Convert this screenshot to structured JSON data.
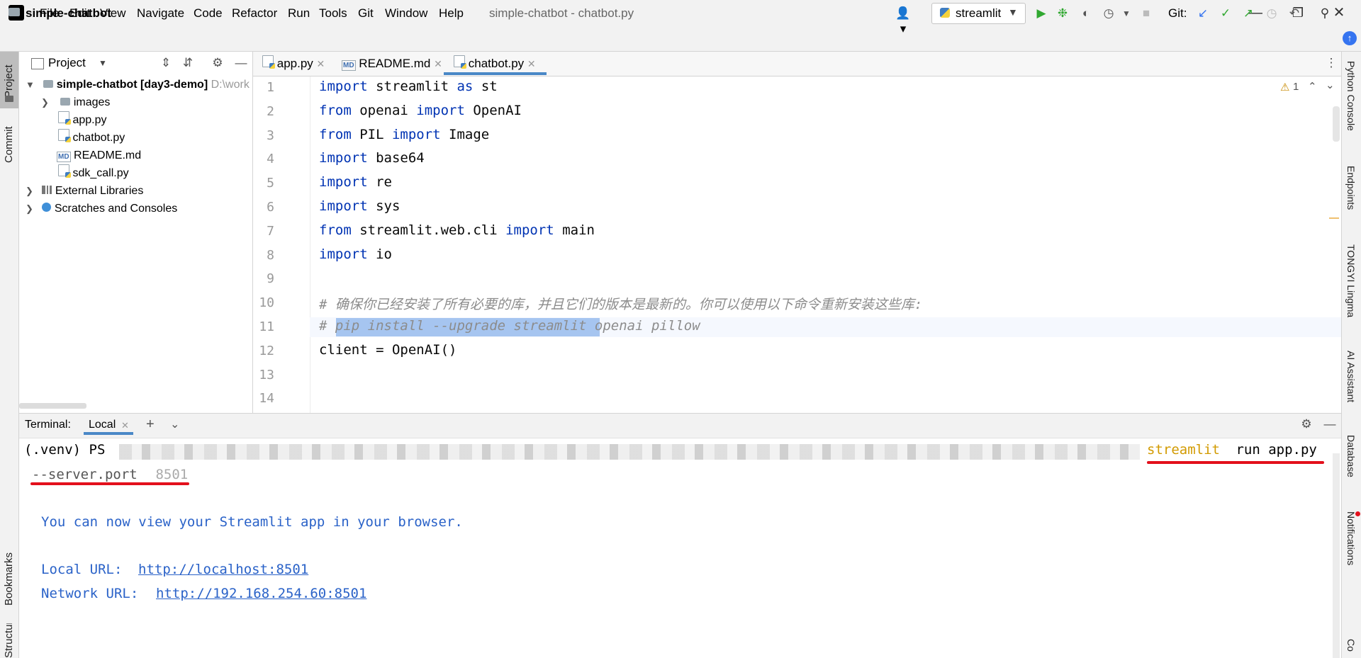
{
  "menu": [
    "File",
    "Edit",
    "View",
    "Navigate",
    "Code",
    "Refactor",
    "Run",
    "Tools",
    "Git",
    "Window",
    "Help"
  ],
  "window_title": "simple-chatbot - chatbot.py",
  "window_controls": [
    "minimize",
    "restore",
    "close"
  ],
  "navbar": {
    "project_name": "simple-chatbot",
    "run_config": "streamlit",
    "git_label": "Git:"
  },
  "left_strip": [
    "Project",
    "Commit",
    "Bookmarks",
    "Structure"
  ],
  "project_panel": {
    "title": "Project",
    "tree": [
      {
        "label": "simple-chatbot [day3-demo]",
        "extra": "D:\\work",
        "type": "folder",
        "expanded": true,
        "depth": 0
      },
      {
        "label": "images",
        "type": "folder",
        "expanded": false,
        "depth": 1
      },
      {
        "label": "app.py",
        "type": "py",
        "depth": 1
      },
      {
        "label": "chatbot.py",
        "type": "py",
        "depth": 1
      },
      {
        "label": "README.md",
        "type": "md",
        "depth": 1
      },
      {
        "label": "sdk_call.py",
        "type": "py",
        "depth": 1
      },
      {
        "label": "External Libraries",
        "type": "lib",
        "depth": 0
      },
      {
        "label": "Scratches and Consoles",
        "type": "scratch",
        "depth": 0
      }
    ]
  },
  "editor": {
    "tabs": [
      {
        "label": "app.py",
        "active": false
      },
      {
        "label": "README.md",
        "active": false
      },
      {
        "label": "chatbot.py",
        "active": true
      }
    ],
    "warnings": "1",
    "lines": [
      {
        "n": "1",
        "tokens": [
          {
            "t": "import",
            "k": "kw"
          },
          {
            "t": " streamlit "
          },
          {
            "t": "as",
            "k": "kw"
          },
          {
            "t": " st"
          }
        ]
      },
      {
        "n": "2",
        "tokens": [
          {
            "t": "from",
            "k": "kw"
          },
          {
            "t": " openai "
          },
          {
            "t": "import",
            "k": "kw"
          },
          {
            "t": " OpenAI"
          }
        ]
      },
      {
        "n": "3",
        "tokens": [
          {
            "t": "from",
            "k": "kw"
          },
          {
            "t": " PIL "
          },
          {
            "t": "import",
            "k": "kw"
          },
          {
            "t": " Image"
          }
        ]
      },
      {
        "n": "4",
        "tokens": [
          {
            "t": "import",
            "k": "kw"
          },
          {
            "t": " base64"
          }
        ]
      },
      {
        "n": "5",
        "tokens": [
          {
            "t": "import",
            "k": "kw"
          },
          {
            "t": " re"
          }
        ]
      },
      {
        "n": "6",
        "tokens": [
          {
            "t": "import",
            "k": "kw"
          },
          {
            "t": " sys"
          }
        ]
      },
      {
        "n": "7",
        "tokens": [
          {
            "t": "from",
            "k": "kw"
          },
          {
            "t": " streamlit.web.cli "
          },
          {
            "t": "import",
            "k": "kw"
          },
          {
            "t": " main"
          }
        ]
      },
      {
        "n": "8",
        "tokens": [
          {
            "t": "import",
            "k": "kw"
          },
          {
            "t": " io"
          }
        ]
      },
      {
        "n": "9",
        "tokens": []
      },
      {
        "n": "10",
        "tokens": [
          {
            "t": "# 确保你已经安装了所有必要的库，并且它们的版本是最新的。你可以使用以下命令重新安装这些库:",
            "k": "cm"
          }
        ]
      },
      {
        "n": "11",
        "tokens": [
          {
            "t": "# pip install --upgrade streamlit openai pillow",
            "k": "cm"
          }
        ]
      },
      {
        "n": "12",
        "tokens": [
          {
            "t": "client = OpenAI()"
          }
        ]
      },
      {
        "n": "13",
        "tokens": []
      },
      {
        "n": "14",
        "tokens": []
      }
    ]
  },
  "terminal": {
    "title": "Terminal:",
    "tab": "Local",
    "prompt": "(.venv) PS",
    "cmd_part1": "streamlit",
    "cmd_part2": " run app.py",
    "cmd_line2_flag": "--server.port",
    "cmd_line2_value": " 8501",
    "output_msg": "You can now view your Streamlit app in your browser.",
    "local_label": "Local URL: ",
    "local_url": "http://localhost:8501",
    "network_label": "Network URL: ",
    "network_url": "http://192.168.254.60:8501"
  },
  "right_strip": [
    "Python Console",
    "Endpoints",
    "TONGYI Lingma",
    "AI Assistant",
    "Database",
    "Notifications",
    "Co"
  ],
  "colors": {
    "keyword": "#0033b3",
    "comment": "#8c8c8c",
    "selection": "#a6c5f0",
    "terminal_blue": "#2a62c8",
    "streamlit_yellow": "#d29a00",
    "annotation_red": "#e3101c"
  }
}
